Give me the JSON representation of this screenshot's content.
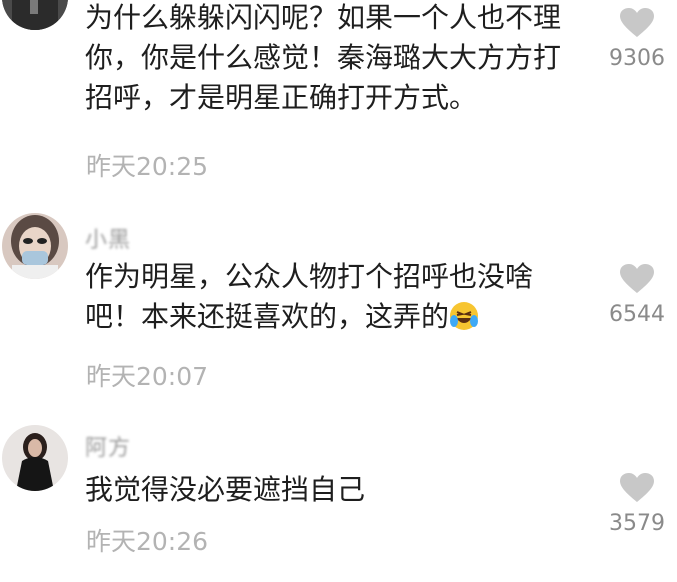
{
  "comments": [
    {
      "text": "为什么躲躲闪闪呢？如果一个人也不理你，你是什么感觉！秦海璐大大方方打招呼，才是明星正确打开方式。",
      "time": "昨天20:25",
      "likes": "9306",
      "avatar": "avatar-dark"
    },
    {
      "username": "小黑",
      "text": "作为明星，公众人物打个招呼也没啥吧！本来还挺喜欢的，这弄的",
      "emoji": "rofl-emoji",
      "time": "昨天20:07",
      "likes": "6544",
      "avatar": "avatar-woman-mask"
    },
    {
      "username": "阿方",
      "text": "我觉得没必要遮挡自己",
      "time": "昨天20:26",
      "likes": "3579",
      "avatar": "avatar-woman-black"
    }
  ],
  "colors": {
    "text": "#1e1e1e",
    "time": "#b3b3b3",
    "like_icon": "#c8c8c8",
    "like_count": "#8a8a8a"
  }
}
